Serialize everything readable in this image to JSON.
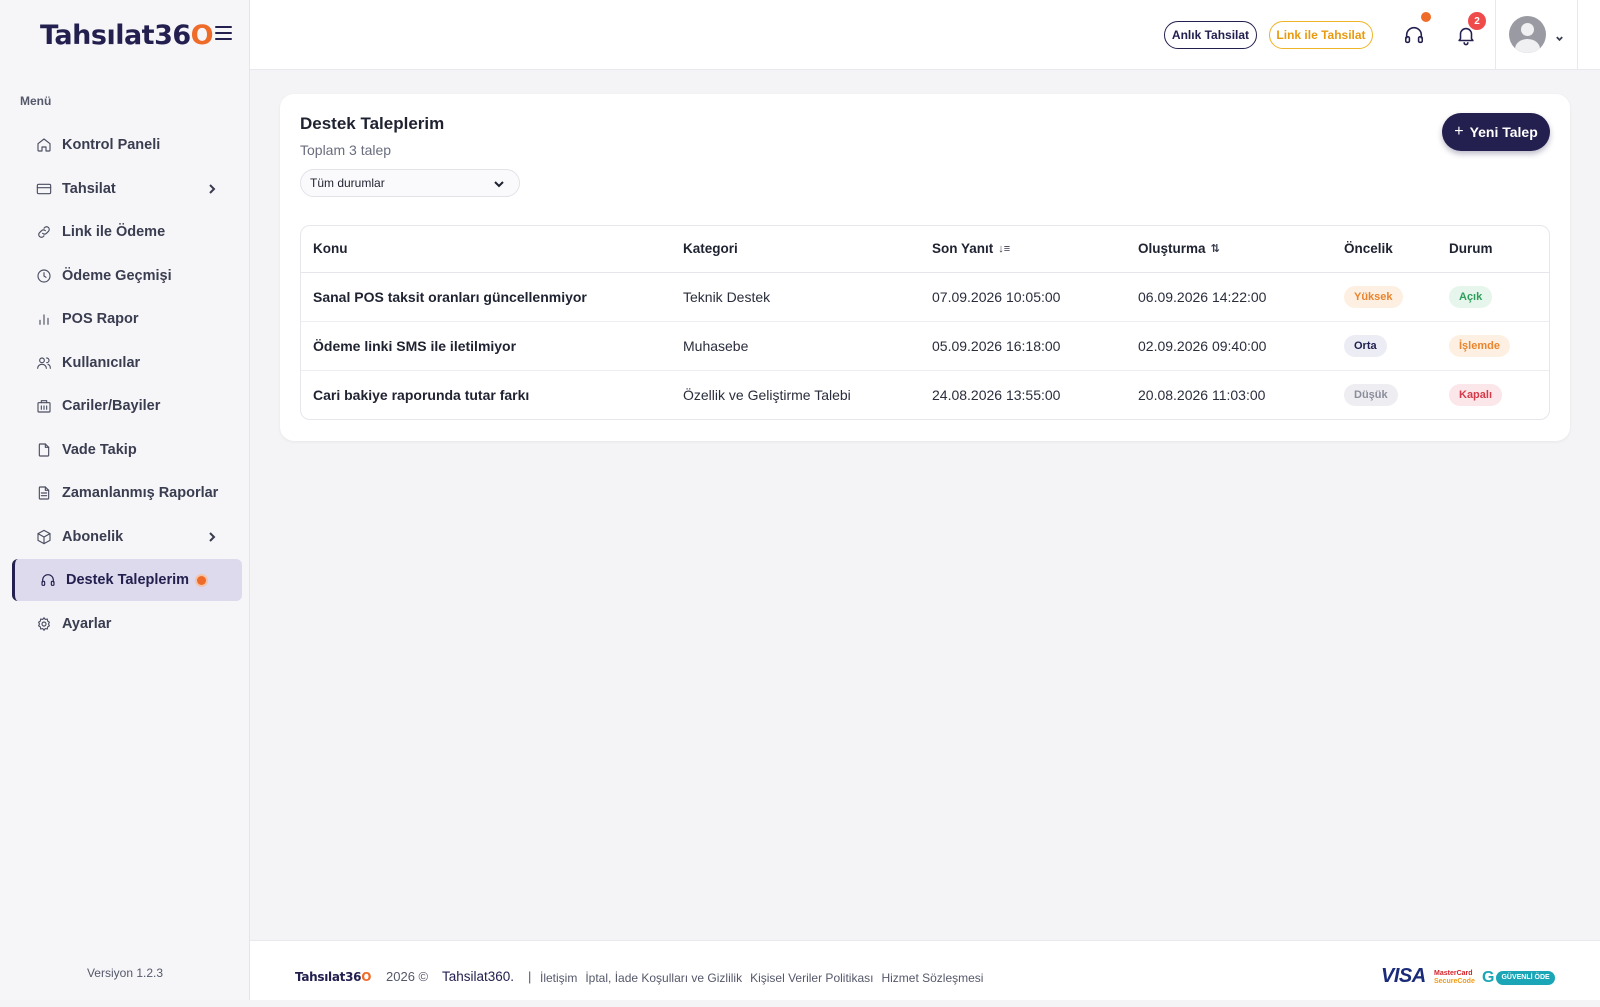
{
  "app": {
    "logo_main": "Tahsılat36",
    "logo_accent": "O"
  },
  "sidebar": {
    "menu_title": "Menü",
    "items": [
      {
        "label": "Kontrol Paneli",
        "icon": "home-icon"
      },
      {
        "label": "Tahsilat",
        "icon": "credit-card-icon",
        "has_submenu": true
      },
      {
        "label": "Link ile Ödeme",
        "icon": "link-icon"
      },
      {
        "label": "Ödeme Geçmişi",
        "icon": "clock-icon"
      },
      {
        "label": "POS Rapor",
        "icon": "bar-chart-icon"
      },
      {
        "label": "Kullanıcılar",
        "icon": "users-icon"
      },
      {
        "label": "Cariler/Bayiler",
        "icon": "building-icon"
      },
      {
        "label": "Vade Takip",
        "icon": "document-icon"
      },
      {
        "label": "Zamanlanmış Raporlar",
        "icon": "report-icon"
      },
      {
        "label": "Abonelik",
        "icon": "box-icon",
        "has_submenu": true
      },
      {
        "label": "Destek Taleplerim",
        "icon": "headset-icon",
        "active": true,
        "has_dot": true
      },
      {
        "label": "Ayarlar",
        "icon": "gear-icon"
      }
    ],
    "version": "Versiyon 1.2.3"
  },
  "header": {
    "btn_anlik": "Anlık Tahsilat",
    "btn_link": "Link ile Tahsilat",
    "notification_count": "2",
    "accent_orange": "#ef6b2a",
    "primary": "#23204f"
  },
  "main": {
    "title": "Destek Taleplerim",
    "subtitle": "Toplam 3 talep",
    "filter_value": "Tüm durumlar",
    "new_button": "Yeni Talep",
    "new_button_plus": "+",
    "columns": {
      "subject": "Konu",
      "category": "Kategori",
      "last_reply": "Son Yanıt",
      "created": "Oluşturma",
      "priority": "Öncelik",
      "status": "Durum"
    },
    "rows": [
      {
        "subject": "Sanal POS taksit oranları güncellenmiyor",
        "category": "Teknik Destek",
        "last_reply": "07.09.2026 10:05:00",
        "created": "06.09.2026 14:22:00",
        "priority": "Yüksek",
        "priority_color": "#e8852e",
        "priority_bg": "#fdf0e2",
        "status": "Açık",
        "status_color": "#2f9e5a",
        "status_bg": "#e6f6ec"
      },
      {
        "subject": "Ödeme linki SMS ile iletilmiyor",
        "category": "Muhasebe",
        "last_reply": "05.09.2026 16:18:00",
        "created": "02.09.2026 09:40:00",
        "priority": "Orta",
        "priority_color": "#23204f",
        "priority_bg": "#ecedf4",
        "status": "İşlemde",
        "status_color": "#e8852e",
        "status_bg": "#fdf0e2"
      },
      {
        "subject": "Cari bakiye raporunda tutar farkı",
        "category": "Özellik ve Geliştirme Talebi",
        "last_reply": "24.08.2026 13:55:00",
        "created": "20.08.2026 11:03:00",
        "priority": "Düşük",
        "priority_color": "#8a8d9a",
        "priority_bg": "#eeeef2",
        "status": "Kapalı",
        "status_color": "#d63a4a",
        "status_bg": "#fbe6e9"
      }
    ]
  },
  "footer": {
    "logo_main": "Tahsılat36",
    "logo_accent": "O",
    "copyright": "2026 ©",
    "brand": "Tahsilat360.",
    "separator": "|",
    "links": [
      "İletişim",
      "İptal, İade Koşulları ve Gizlilik",
      "Kişisel Veriler Politikası",
      "Hizmet Sözleşmesi"
    ],
    "visa": "VISA",
    "mastercard_line1": "MasterCard",
    "mastercard_line2": "SecureCode",
    "guvenli_g": "G",
    "guvenli_label": "GÜVENLİ ÖDE"
  }
}
